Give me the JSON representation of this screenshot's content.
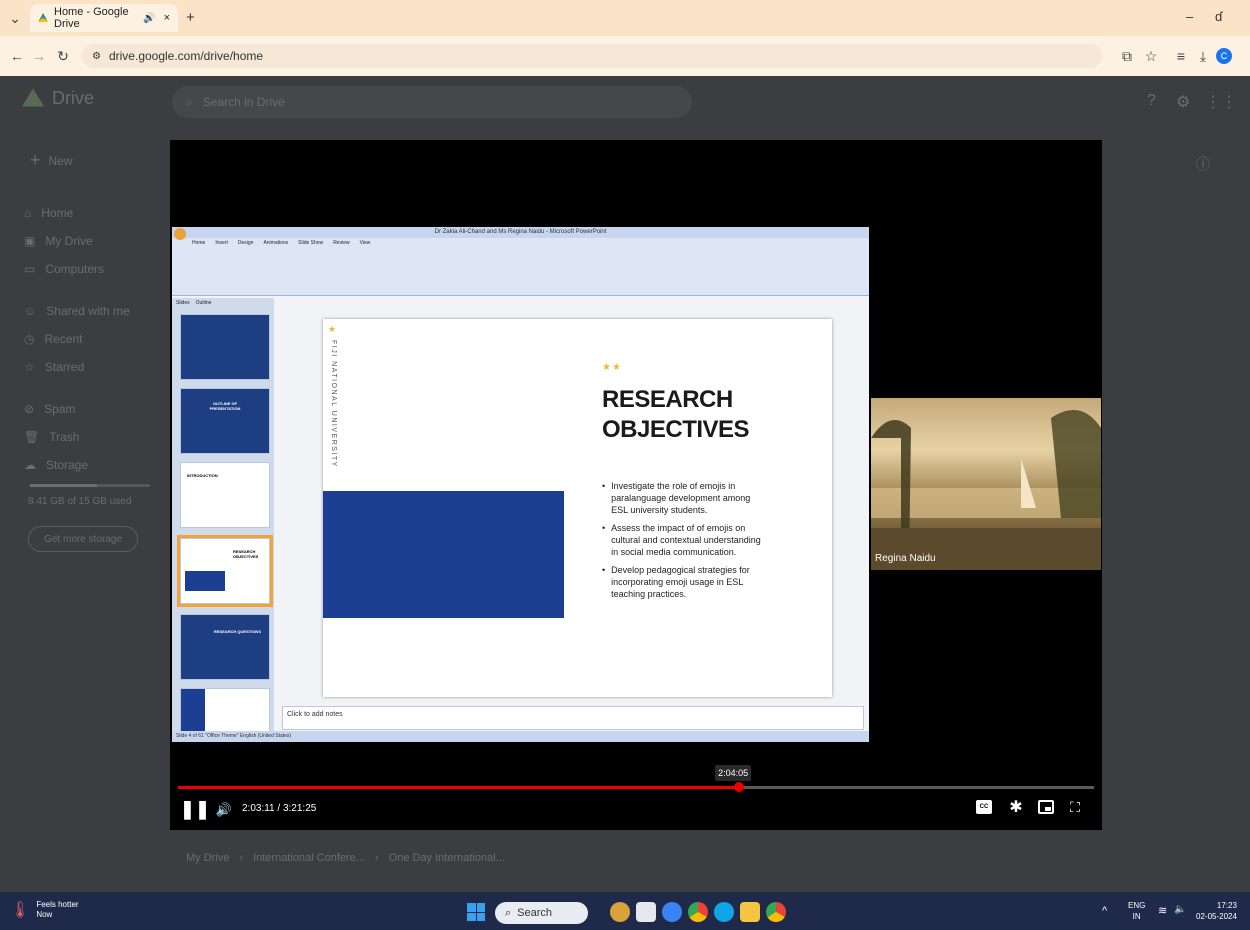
{
  "browser": {
    "tab_title": "Home - Google Drive",
    "tab_close": "×",
    "new_tab": "+",
    "url": "drive.google.com/drive/home",
    "window_controls": {
      "minimize": "–",
      "restore": "ɗ"
    }
  },
  "drive": {
    "app_name": "Drive",
    "search_placeholder": "Search in Drive",
    "new_button": "New",
    "nav": [
      "Home",
      "My Drive",
      "Computers",
      "Shared with me",
      "Recent",
      "Starred",
      "Spam",
      "Trash",
      "Storage"
    ],
    "storage_text": "8.41 GB of 15 GB used",
    "get_storage": "Get more storage",
    "breadcrumb": [
      "My Drive",
      "International Confere...",
      "One Day International..."
    ]
  },
  "ppt": {
    "window_title": "Dr Zakia Ali-Chand and Ms Regina Naidu - Microsoft PowerPoint",
    "tabs": [
      "Home",
      "Insert",
      "Design",
      "Animations",
      "Slide Show",
      "Review",
      "View"
    ],
    "panel_tabs": [
      "Slides",
      "Outline"
    ],
    "notes_placeholder": "Click to add notes",
    "status": "Slide 4 of 61   \"Office Theme\"   English (United States)",
    "slide": {
      "vertical_text": "FIJI NATIONAL UNIVERSITY",
      "stars": "★★",
      "title_line1": "RESEARCH",
      "title_line2": "OBJECTIVES",
      "bullets": [
        "Investigate the role of emojis in paralanguage development among ESL university students.",
        "Assess the impact of of emojis on cultural and contextual understanding in social media communication.",
        "Develop pedagogical strategies for incorporating emoji usage in ESL teaching practices."
      ]
    },
    "thumb_titles": [
      "OUTLINE OF PRESENTATION",
      "INTRODUCTION",
      "RESEARCH OBJECTIVES",
      "RESEARCH QUESTIONS"
    ]
  },
  "participant": {
    "name": "Regina Naidu"
  },
  "player": {
    "time": "2:03:11 / 3:21:25",
    "hover_time": "2:04:05",
    "progress": 0.612,
    "hover_progress": 0.606,
    "progress_color": "#ee0000"
  },
  "taskbar": {
    "weather_line1": "Feels hotter",
    "weather_line2": "Now",
    "search": "Search",
    "lang1": "ENG",
    "lang2": "IN",
    "time": "17:23",
    "date": "02-05-2024"
  }
}
